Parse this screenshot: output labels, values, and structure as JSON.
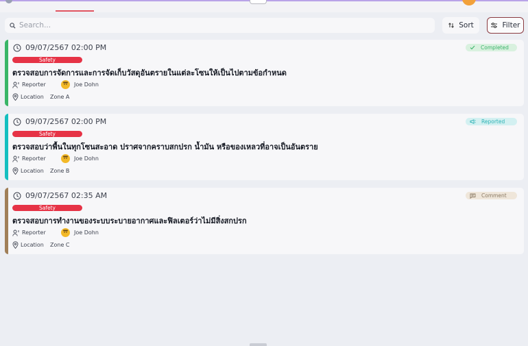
{
  "search": {
    "placeholder": "Search..."
  },
  "toolbar": {
    "sort_label": "Sort",
    "filter_label": "Filter"
  },
  "colors": {
    "completed": "#39b567",
    "reported": "#14bfc0",
    "comment": "#a07f58",
    "tag": "#e63346"
  },
  "cards": [
    {
      "datetime": "09/07/2567 02:00 PM",
      "tag": "Safety",
      "title": "ตรวจสอบการจัดการและการจัดเก็บวัสดุอันตรายในแต่ละโซนให้เป็นไปตามข้อกำหนด",
      "reporter_label": "Reporter",
      "reporter_name": "Joe Dohn",
      "location_label": "Location",
      "location_value": "Zone A",
      "status": "Completed",
      "status_icon": "check-icon"
    },
    {
      "datetime": "09/07/2567 02:00 PM",
      "tag": "Safety",
      "title": "ตรวจสอบว่าพื้นในทุกโซนสะอาด ปราศจากคราบสกปรก น้ำมัน หรือของเหลวที่อาจเป็นอันตราย",
      "reporter_label": "Reporter",
      "reporter_name": "Joe Dohn",
      "location_label": "Location",
      "location_value": "Zone B",
      "status": "Reported",
      "status_icon": "megaphone-icon"
    },
    {
      "datetime": "09/07/2567 02:35 AM",
      "tag": "Safety",
      "title": "ตรวจสอบการทำงานของระบบระบายอากาศและฟิลเตอร์ว่าไม่มีสิ่งสกปรก",
      "reporter_label": "Reporter",
      "reporter_name": "Joe Dohn",
      "location_label": "Location",
      "location_value": "Zone C",
      "status": "Comment",
      "status_icon": "comment-icon"
    }
  ]
}
